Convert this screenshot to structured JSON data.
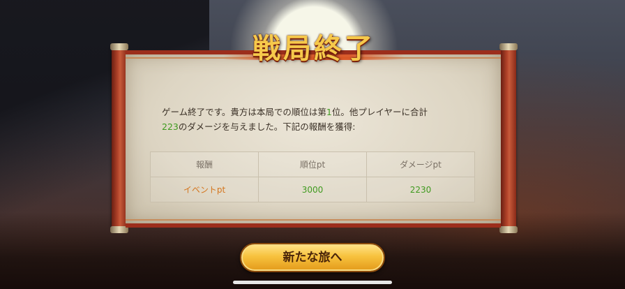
{
  "title": "戦局終了",
  "message": {
    "part1": "ゲーム終了です。貴方は本局での順位は第",
    "rank": "1",
    "part2": "位。他プレイヤーに合計",
    "damage": "223",
    "part3": "のダメージを与えました。下記の報酬を獲得:"
  },
  "rewards_table": {
    "headers": [
      "報酬",
      "順位pt",
      "ダメージpt"
    ],
    "row": {
      "name": "イベントpt",
      "rank_pt": "3000",
      "damage_pt": "2230"
    }
  },
  "button_label": "新たな旅へ",
  "colors": {
    "highlight_green": "#3f9a1f",
    "reward_orange": "#d4761f",
    "scroll_red": "#9c2e1c",
    "button_gold": "#f7c23e"
  }
}
